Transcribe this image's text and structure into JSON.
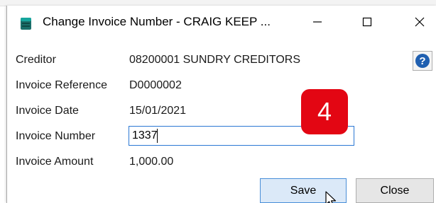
{
  "window": {
    "title": "Change Invoice Number - CRAIG KEEP ...",
    "minimize_icon": "minimize-icon",
    "maximize_icon": "maximize-icon",
    "close_icon": "close-icon"
  },
  "help": {
    "icon": "help-icon",
    "glyph": "?"
  },
  "fields": {
    "creditor": {
      "label": "Creditor",
      "value": "08200001 SUNDRY CREDITORS"
    },
    "invoice_reference": {
      "label": "Invoice Reference",
      "value": "D0000002"
    },
    "invoice_date": {
      "label": "Invoice Date",
      "value": "15/01/2021"
    },
    "invoice_number": {
      "label": "Invoice Number",
      "value": "1337"
    },
    "invoice_amount": {
      "label": "Invoice Amount",
      "value": "1,000.00"
    }
  },
  "annotation": {
    "step": "4",
    "color": "#e30613"
  },
  "buttons": {
    "save_label": "Save",
    "close_label": "Close"
  },
  "colors": {
    "accent": "#2b78d4",
    "help_blue": "#1f5fb0",
    "save_bg": "#dbe9f8"
  }
}
